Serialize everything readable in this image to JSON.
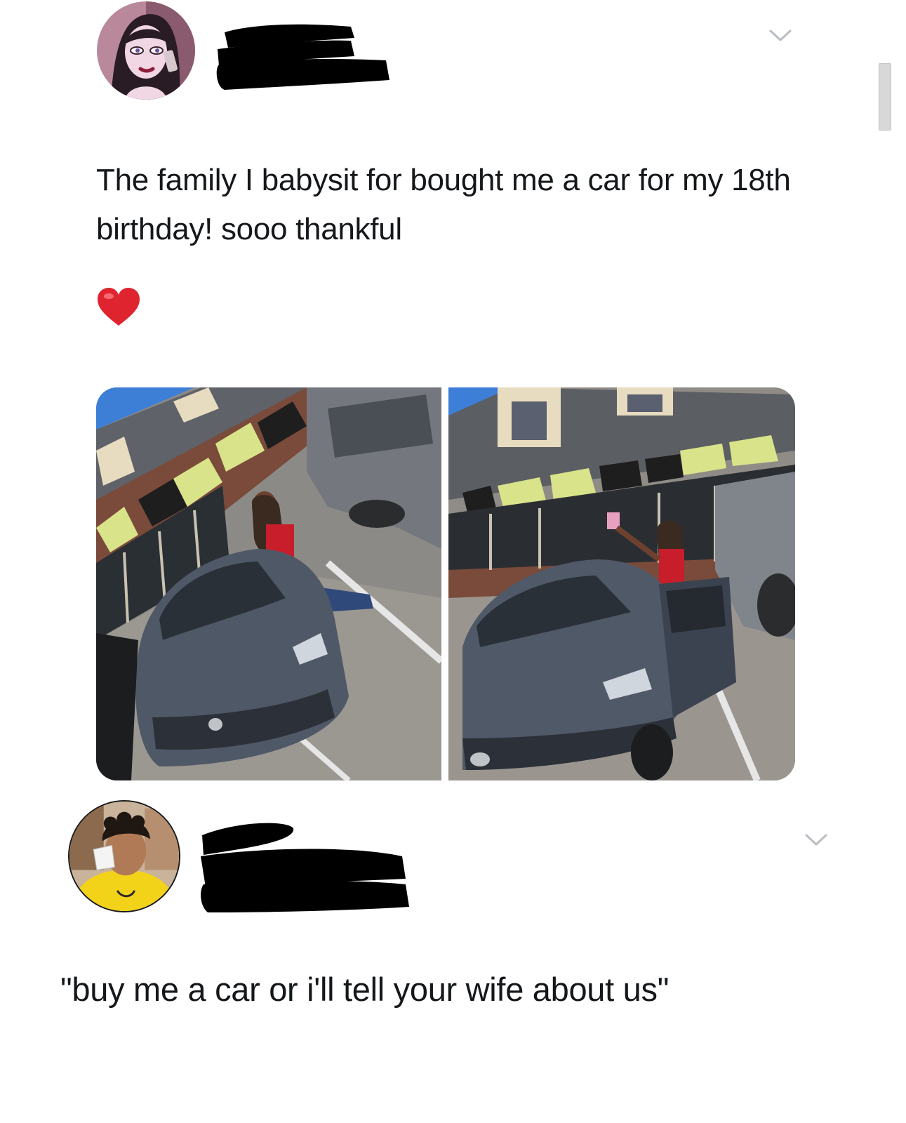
{
  "tweet1": {
    "text": "The family I babysit for bought me a car for my 18th birthday! sooo thankful",
    "emoji": "red-heart",
    "media": [
      "photo-1",
      "photo-2"
    ]
  },
  "tweet2": {
    "text": "\"buy me a car or i'll tell your wife about us\""
  },
  "colors": {
    "text": "#15181b",
    "background": "#ffffff",
    "redaction": "#000000",
    "heart": "#e0242f"
  }
}
